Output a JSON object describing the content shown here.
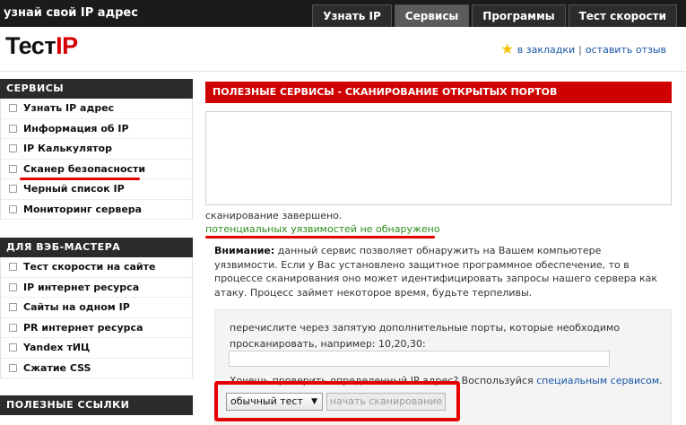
{
  "topbar": {
    "tagline": "узнай свой IP адрес",
    "tabs": [
      {
        "label": "Узнать IP",
        "active": false
      },
      {
        "label": "Сервисы",
        "active": true
      },
      {
        "label": "Программы",
        "active": false
      },
      {
        "label": "Тест скорости",
        "active": false
      }
    ]
  },
  "header": {
    "logo_text": "Тест",
    "logo_accent": "IP",
    "bookmark_label": "в закладки",
    "separator": "|",
    "feedback_label": "оставить отзыв"
  },
  "sidebar": {
    "sections": [
      {
        "title": "СЕРВИСЫ",
        "items": [
          "Узнать IP адрес",
          "Информация об IP",
          "IP Калькулятор",
          "Сканер безопасности",
          "Черный список IP",
          "Мониторинг сервера"
        ]
      },
      {
        "title": "ДЛЯ ВЭБ-МАСТЕРА",
        "items": [
          "Тест скорости на сайте",
          "IP интернет ресурса",
          "Сайты на одном IP",
          "PR интернет ресурса",
          "Yandex тИЦ",
          "Сжатие CSS"
        ]
      },
      {
        "title": "ПОЛЕЗНЫЕ ССЫЛКИ",
        "items": []
      }
    ]
  },
  "main": {
    "title": "ПОЛЕЗНЫЕ СЕРВИСЫ - СКАНИРОВАНИЕ ОТКРЫТЫХ ПОРТОВ",
    "status": "сканирование завершено.",
    "result": "потенциальных уязвимостей не обнаружено",
    "note_label": "Внимание:",
    "note_text": " данный сервис позволяет обнаружить на Вашем компьютере уязвимости. Если у Вас установлено защитное программное обеспечение, то в процессе сканирования оно может идентифицировать запросы нашего сервера как атаку. Процесс займет некоторое время, будьте терпеливы.",
    "ports_text": "перечислите через запятую дополнительные порты, которые необходимо просканировать, например: 10,20,30:",
    "ports_value": "",
    "check_text": "Хочешь проверить определенный IP адрес? Воспользуйся ",
    "check_link": "специальным сервисом",
    "check_end": ".",
    "scan_type": "обычный тест",
    "scan_button": "начать сканирование"
  },
  "colors": {
    "accent_red": "#cf0000",
    "ok_green": "#2c8a1a",
    "link_blue": "#1a55a5"
  }
}
